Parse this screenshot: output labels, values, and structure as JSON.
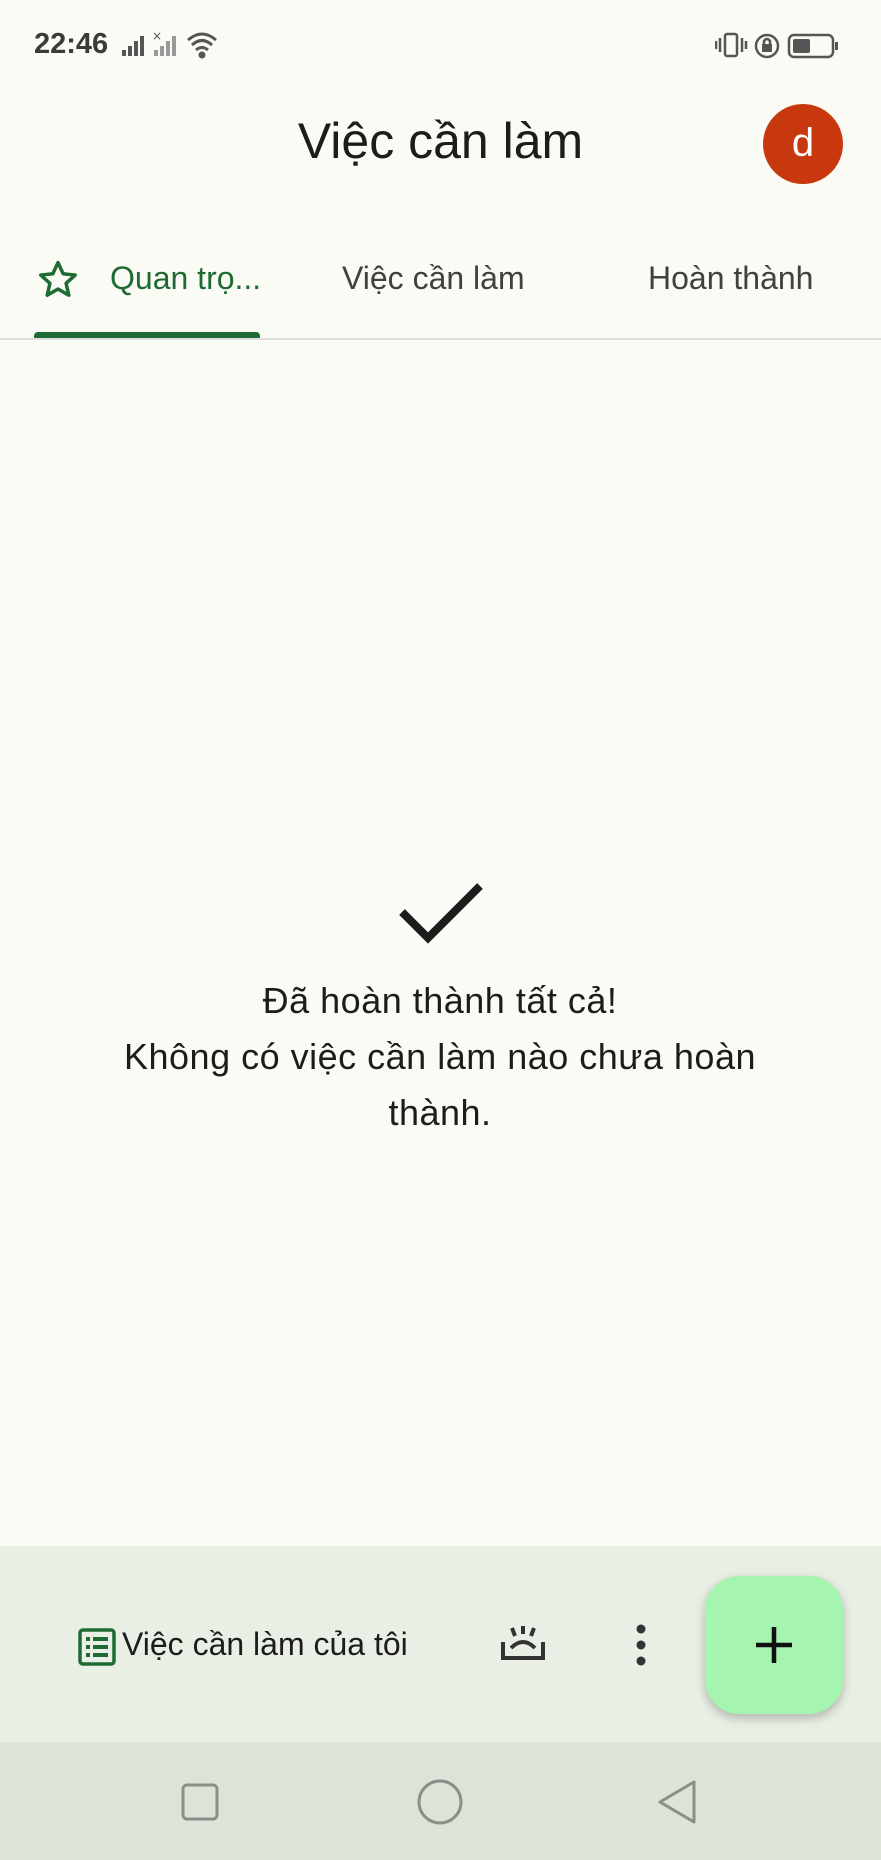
{
  "status_bar": {
    "time": "22:46",
    "left_icons": [
      "signal-bars-icon",
      "signal-bars-no-service-icon",
      "wifi-icon"
    ],
    "right_icons": [
      "vibrate-icon",
      "rotation-lock-icon",
      "battery-icon"
    ]
  },
  "header": {
    "title": "Việc cần làm",
    "avatar_letter": "d",
    "avatar_color": "#c8380e"
  },
  "tabs": [
    {
      "label": "Quan trọ...",
      "icon": "star-icon",
      "selected": true
    },
    {
      "label": "Việc cần làm",
      "selected": false
    },
    {
      "label": "Hoàn thành",
      "selected": false
    }
  ],
  "empty_state": {
    "icon": "checkmark-icon",
    "line1": "Đã hoàn thành tất cả!",
    "line2": "Không có việc cần làm nào chưa hoàn thành."
  },
  "bottom_bar": {
    "list_label": "Việc cần làm của tôi",
    "list_icon": "task-list-icon",
    "sort_icon": "sort-tray-icon",
    "more_icon": "more-vert-icon",
    "fab_icon": "plus-icon"
  },
  "nav_bar": {
    "buttons": [
      "recents-square-icon",
      "home-circle-icon",
      "back-triangle-icon"
    ]
  },
  "colors": {
    "accent": "#1d6b33",
    "fab": "#a5f5b0",
    "background": "#fbfbf5",
    "bottom_bar": "#e9efe5",
    "nav_bar": "#dee3da"
  }
}
